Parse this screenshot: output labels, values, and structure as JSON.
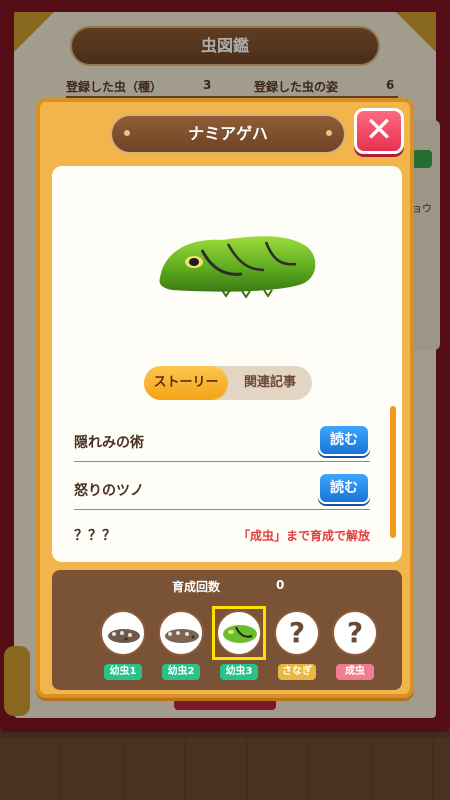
{
  "background": {
    "book_title": "虫図鑑",
    "registered_species_label": "登録した虫（種）",
    "registered_species_value": "3",
    "registered_forms_label": "登録した虫の姿",
    "registered_forms_value": "6",
    "side_text": "ョウ"
  },
  "modal": {
    "title": "ナミアゲハ",
    "close_icon": "close-icon",
    "tabs": [
      {
        "label": "ストーリー",
        "active": true
      },
      {
        "label": "関連記事",
        "active": false
      }
    ],
    "stories": [
      {
        "title": "隠れみの術",
        "button": "読む"
      },
      {
        "title": "怒りのツノ",
        "button": "読む"
      }
    ],
    "locked": {
      "title": "？？？",
      "message": "「成虫」まで育成で解放"
    },
    "growth": {
      "label": "育成回数",
      "count": "0",
      "stages": [
        {
          "label": "幼虫1",
          "unlocked": true,
          "selected": false
        },
        {
          "label": "幼虫2",
          "unlocked": true,
          "selected": false
        },
        {
          "label": "幼虫3",
          "unlocked": true,
          "selected": true
        },
        {
          "label": "さなぎ",
          "unlocked": false,
          "selected": false,
          "symbol": "?"
        },
        {
          "label": "成虫",
          "unlocked": false,
          "selected": false,
          "symbol": "?"
        }
      ]
    }
  },
  "colors": {
    "modal_fill": "#f2b54c",
    "close_button": "#e5324f",
    "read_button": "#1a74d6",
    "active_tab": "#f3a318",
    "lock_message": "#e23e3e"
  }
}
